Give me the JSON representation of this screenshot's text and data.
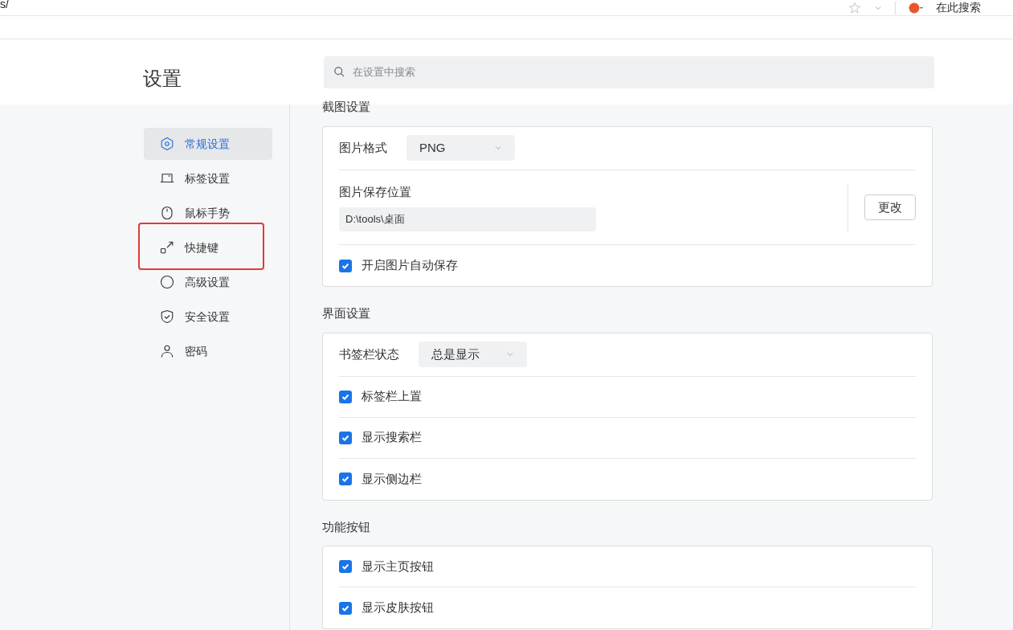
{
  "browser": {
    "url": "s/",
    "search_label": "在此搜索"
  },
  "header": {
    "title": "设置",
    "search": {
      "placeholder": "在设置中搜索"
    }
  },
  "sidebar": {
    "items": [
      {
        "label": "常规设置",
        "selected": true,
        "highlighted": false
      },
      {
        "label": "标签设置",
        "selected": false,
        "highlighted": false
      },
      {
        "label": "鼠标手势",
        "selected": false,
        "highlighted": false
      },
      {
        "label": "快捷键",
        "selected": false,
        "highlighted": true
      },
      {
        "label": "高级设置",
        "selected": false,
        "highlighted": false
      },
      {
        "label": "安全设置",
        "selected": false,
        "highlighted": false
      },
      {
        "label": "密码",
        "selected": false,
        "highlighted": false
      }
    ]
  },
  "sections": [
    {
      "title": "截图设置",
      "rows": [
        {
          "kind": "select",
          "label": "图片格式",
          "value": "PNG"
        },
        {
          "kind": "path",
          "label": "图片保存位置",
          "value": "D:\\tools\\桌面",
          "button": "更改"
        },
        {
          "kind": "checkbox",
          "label": "开启图片自动保存",
          "checked": true
        }
      ]
    },
    {
      "title": "界面设置",
      "rows": [
        {
          "kind": "select",
          "label": "书签栏状态",
          "value": "总是显示"
        },
        {
          "kind": "checkbox",
          "label": "标签栏上置",
          "checked": true
        },
        {
          "kind": "checkbox",
          "label": "显示搜索栏",
          "checked": true
        },
        {
          "kind": "checkbox",
          "label": "显示侧边栏",
          "checked": true
        }
      ]
    },
    {
      "title": "功能按钮",
      "rows": [
        {
          "kind": "checkbox",
          "label": "显示主页按钮",
          "checked": true
        },
        {
          "kind": "checkbox",
          "label": "显示皮肤按钮",
          "checked": true
        }
      ]
    }
  ]
}
